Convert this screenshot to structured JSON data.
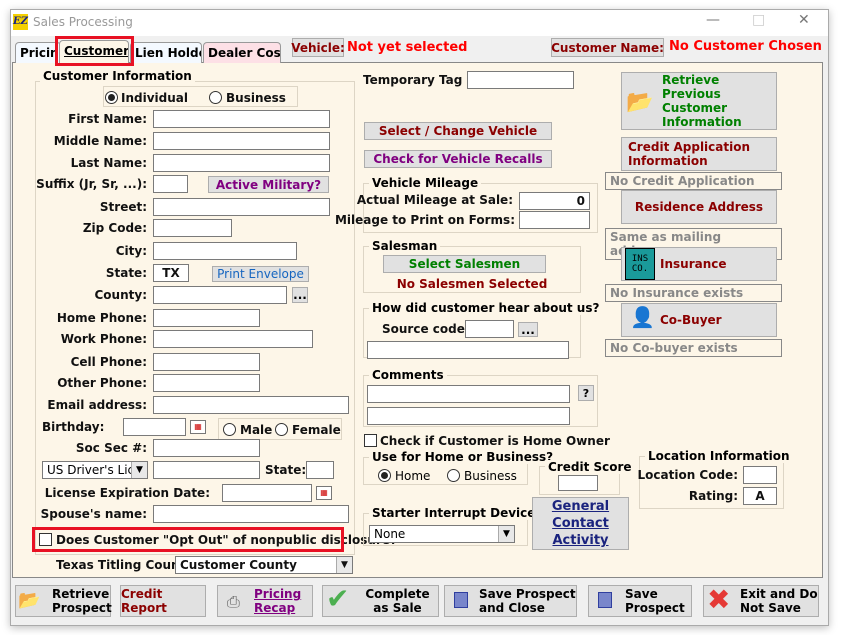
{
  "window": {
    "title": "Sales Processing",
    "logo": "EZ"
  },
  "tabs": [
    {
      "label": "Pricing"
    },
    {
      "label": "Customer"
    },
    {
      "label": "Lien Holder"
    },
    {
      "label": "Dealer Costs"
    }
  ],
  "header": {
    "vehicle_label": "Vehicle:",
    "vehicle_value": "Not yet selected",
    "customer_label": "Customer Name:",
    "customer_value": "No Customer Chosen"
  },
  "customer_info": {
    "title": "Customer Information",
    "type_options": [
      {
        "label": "Individual",
        "selected": true
      },
      {
        "label": "Business",
        "selected": false
      }
    ],
    "fields": {
      "first_name": "First Name:",
      "middle_name": "Middle Name:",
      "last_name": "Last Name:",
      "suffix": "Suffix (Jr, Sr, ...):",
      "street": "Street:",
      "zip": "Zip Code:",
      "city": "City:",
      "state": "State:",
      "county": "County:",
      "home_phone": "Home Phone:",
      "work_phone": "Work Phone:",
      "cell_phone": "Cell Phone:",
      "other_phone": "Other Phone:",
      "email": "Email address:",
      "birthday": "Birthday:",
      "soc_sec": "Soc Sec #:",
      "dl_state": "State:",
      "license_exp": "License Expiration Date:",
      "spouse": "Spouse's name:"
    },
    "state_value": "TX",
    "active_military": "Active Military?",
    "print_envelope": "Print Envelope",
    "ellipsis": "...",
    "gender": [
      {
        "label": "Male"
      },
      {
        "label": "Female"
      }
    ],
    "id_type": "US Driver's Lic",
    "opt_out": "Does Customer \"Opt Out\" of nonpublic disclosure?",
    "titling_label": "Texas Titling County:",
    "titling_value": "Customer County"
  },
  "middle": {
    "temp_tag": "Temporary Tag #:",
    "select_vehicle": "Select / Change Vehicle",
    "recalls": "Check for Vehicle Recalls",
    "mileage_title": "Vehicle Mileage",
    "actual_mileage": "Actual Mileage at Sale:",
    "actual_mileage_value": "0",
    "print_mileage": "Mileage to Print on Forms:",
    "salesman_title": "Salesman",
    "select_salesmen": "Select Salesmen",
    "no_salesmen": "No Salesmen Selected",
    "hear_title": "How did customer hear about us?",
    "source_code": "Source code:",
    "comments_title": "Comments",
    "help": "?",
    "home_owner": "Check if Customer is Home Owner",
    "use_title": "Use for Home or Business?",
    "use_options": [
      {
        "label": "Home",
        "selected": true
      },
      {
        "label": "Business",
        "selected": false
      }
    ],
    "credit_score": "Credit Score",
    "starter_title": "Starter Interrupt Device",
    "starter_value": "None",
    "general_contact": "General Contact Activity"
  },
  "right": {
    "retrieve_prev": "Retrieve Previous Customer Information",
    "credit_app": "Credit Application Information",
    "credit_status": "No Credit Application",
    "residence": "Residence Address",
    "residence_status": "Same as mailing address",
    "insurance": "Insurance",
    "insurance_status": "No Insurance exists",
    "cobuyer": "Co-Buyer",
    "cobuyer_status": "No Co-buyer exists",
    "location_title": "Location Information",
    "location_code": "Location Code:",
    "rating": "Rating:",
    "rating_value": "A"
  },
  "footer": {
    "retrieve": "Retrieve Prospect",
    "credit_report": "Credit Report",
    "pricing_recap": "Pricing Recap",
    "complete": "Complete as Sale",
    "save_close": "Save Prospect and Close",
    "save": "Save Prospect",
    "exit": "Exit and Do Not Save"
  },
  "colors": {
    "panel": "#fdf6e8",
    "alert_red": "#ff0000",
    "dark_red": "#8b0000",
    "green": "#008000",
    "purple": "#800080",
    "highlight": "#e81123"
  }
}
